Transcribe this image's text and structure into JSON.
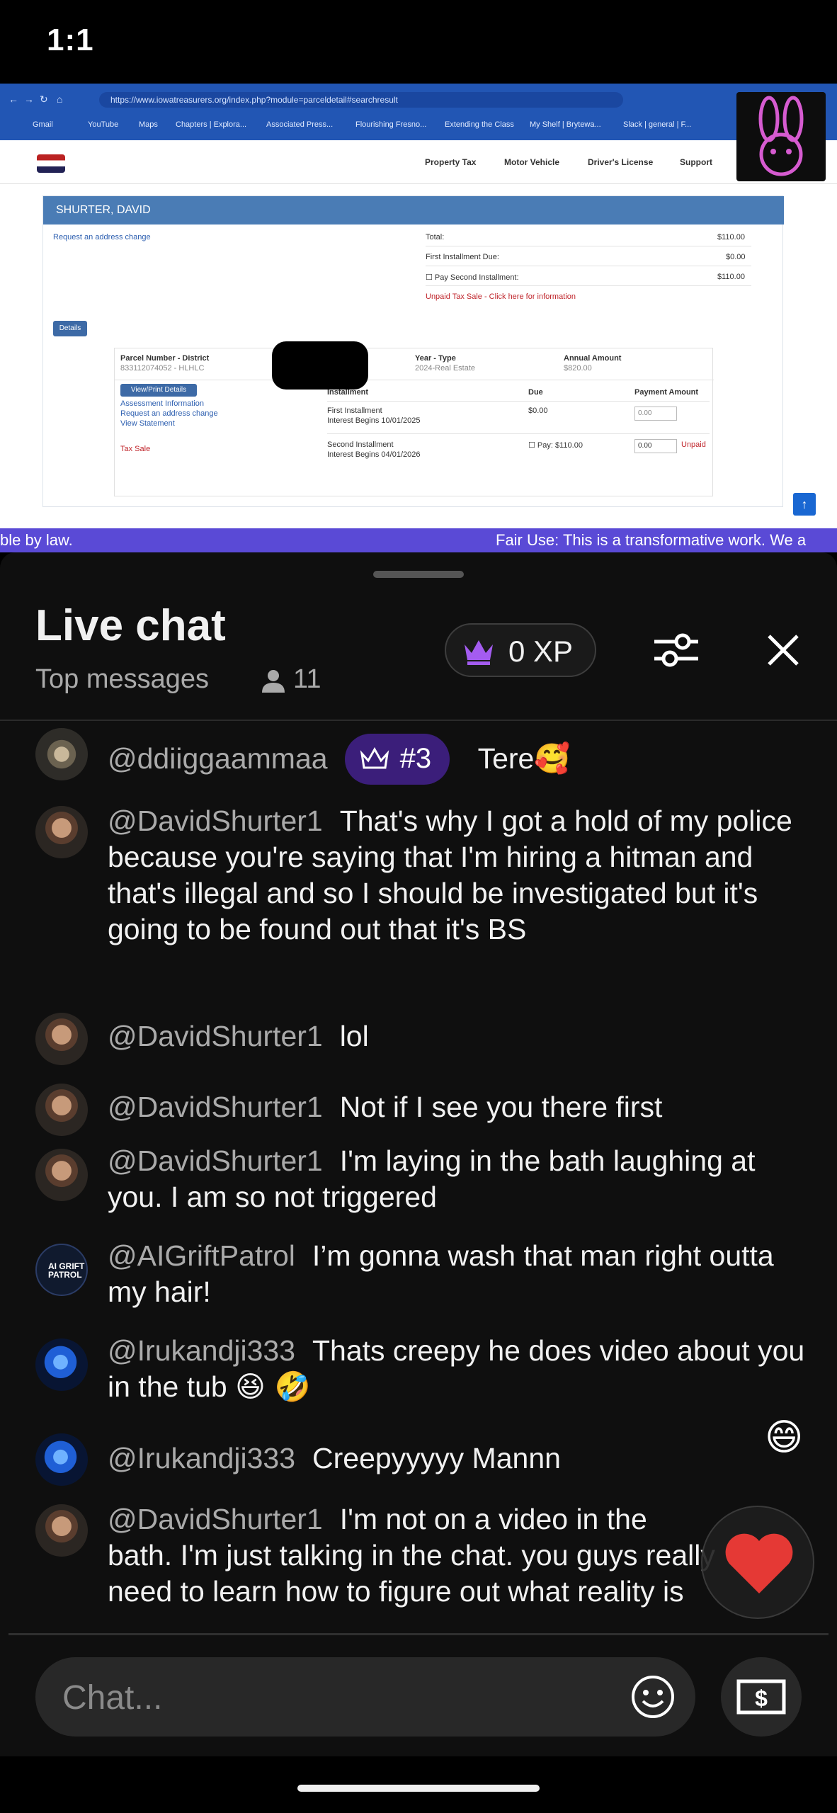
{
  "status_bar": {
    "time": "1:1"
  },
  "video": {
    "browser": {
      "url": "https://www.iowatreasurers.org/index.php?module=parceldetail#searchresult",
      "bookmarks": [
        "Gmail",
        "YouTube",
        "Maps",
        "Chapters | Explora...",
        "Associated Press...",
        "Flourishing Fresno...",
        "Extending the Class",
        "My Shelf | Brytewa...",
        "Slack | general | F..."
      ]
    },
    "site_nav": [
      "Property Tax",
      "Motor Vehicle",
      "Driver's License",
      "Support"
    ],
    "parcel": {
      "owner": "SHURTER, DAVID",
      "address_change": "Request an address change",
      "details_button": "Details",
      "total_label": "Total:",
      "total_value": "$110.00",
      "first_due_label": "First Installment Due:",
      "first_due_value": "$0.00",
      "pay_second_label": "Pay Second Installment:",
      "pay_second_value": "$110.00",
      "unpaid_notice": "Unpaid Tax Sale - Click here for information",
      "parcel_header": "Parcel Number - District",
      "parcel_value": "833112074052 - HLHLC",
      "year_header": "Year - Type",
      "year_value": "2024-Real Estate",
      "annual_header": "Annual Amount",
      "annual_value": "$820.00",
      "view_print": "View/Print Details",
      "links": [
        "Assessment Information",
        "Request an address change",
        "View Statement"
      ],
      "tax_sale": "Tax Sale",
      "installment_header": "Installment",
      "due_header": "Due",
      "payment_header": "Payment Amount",
      "first_installment": "First Installment",
      "first_interest": "Interest Begins 10/01/2025",
      "first_due": "$0.00",
      "first_payment": "0.00",
      "second_installment": "Second Installment",
      "second_interest": "Interest Begins 04/01/2026",
      "second_pay": "Pay: $110.00",
      "second_payment": "0.00",
      "unpaid": "Unpaid"
    },
    "ticker_left": "ble by law.",
    "ticker_right": "Fair Use: This is a transformative work. We a"
  },
  "chat": {
    "title": "Live chat",
    "filter_label": "Top messages",
    "viewer_count": "11",
    "xp_label": "0 XP",
    "messages": [
      {
        "author": "@ddiiggaammaa",
        "badge": "#3",
        "text": "Tere",
        "emoji": "🥰"
      },
      {
        "author": "@DavidShurter1",
        "text": "That's why I got a hold of my police because you're saying that I'm hiring a hitman and that's illegal and so I should be investigated but it's going to be found out that it's BS"
      },
      {
        "author": "@DavidShurter1",
        "text": "lol"
      },
      {
        "author": "@DavidShurter1",
        "text": "Not if I see you there first"
      },
      {
        "author": "@DavidShurter1",
        "text": "I'm laying in the bath laughing at you. I am so not triggered"
      },
      {
        "author": "@AIGriftPatrol",
        "text": "I’m gonna wash that man right outta my hair!",
        "avatar_text": "AI GRIFT PATROL"
      },
      {
        "author": "@Irukandji333",
        "text": "Thats creepy he does video about you in the tub",
        "emoji": "😆 🤣"
      },
      {
        "author": "@Irukandji333",
        "text": "Creepyyyyy Mannn"
      },
      {
        "author": "@DavidShurter1",
        "text": "I'm not on a video in the bath. I'm just talking in the chat. you guys really need to learn how to figure out what reality is"
      }
    ],
    "floating_emoji": "😄",
    "input_placeholder": "Chat..."
  },
  "colors": {
    "accent": "#3b1e7a",
    "ticker": "#5a4ad6",
    "heart": "#e53935"
  }
}
